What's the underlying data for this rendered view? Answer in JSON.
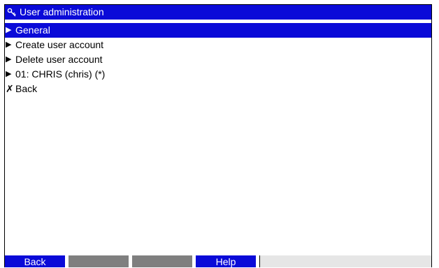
{
  "window": {
    "title": "User administration",
    "title_icon": "wrench-key-icon"
  },
  "menu": {
    "items": [
      {
        "glyph": "▶",
        "label": "General",
        "selected": true
      },
      {
        "glyph": "▶",
        "label": "Create user account",
        "selected": false
      },
      {
        "glyph": "▶",
        "label": "Delete user account",
        "selected": false
      },
      {
        "glyph": "▶",
        "label": "01: CHRIS (chris) (*)",
        "selected": false
      },
      {
        "glyph": "✗",
        "label": "Back",
        "selected": false
      }
    ]
  },
  "softkeys": {
    "key1": "Back",
    "key2": "",
    "key3": "",
    "key4": "Help"
  },
  "colors": {
    "accent": "#0a0ad8",
    "inactive_key": "#7f7f7f",
    "status_area": "#e6e6e6"
  }
}
